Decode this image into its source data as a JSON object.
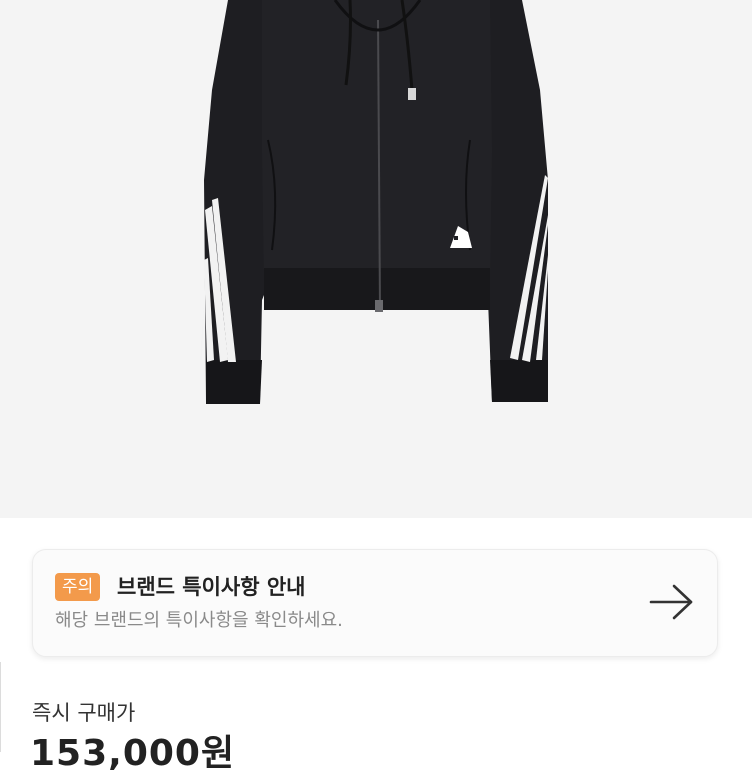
{
  "notice": {
    "badge": "주의",
    "title": "브랜드 특이사항 안내",
    "description": "해당 브랜드의 특이사항을 확인하세요.",
    "arrow_icon": "arrow-right-icon"
  },
  "purchase": {
    "label": "즉시 구매가",
    "price": "153,000원"
  },
  "colors": {
    "image_bg": "#f4f4f4",
    "badge_bg": "#f39a4b",
    "jacket": "#1e1e22"
  }
}
